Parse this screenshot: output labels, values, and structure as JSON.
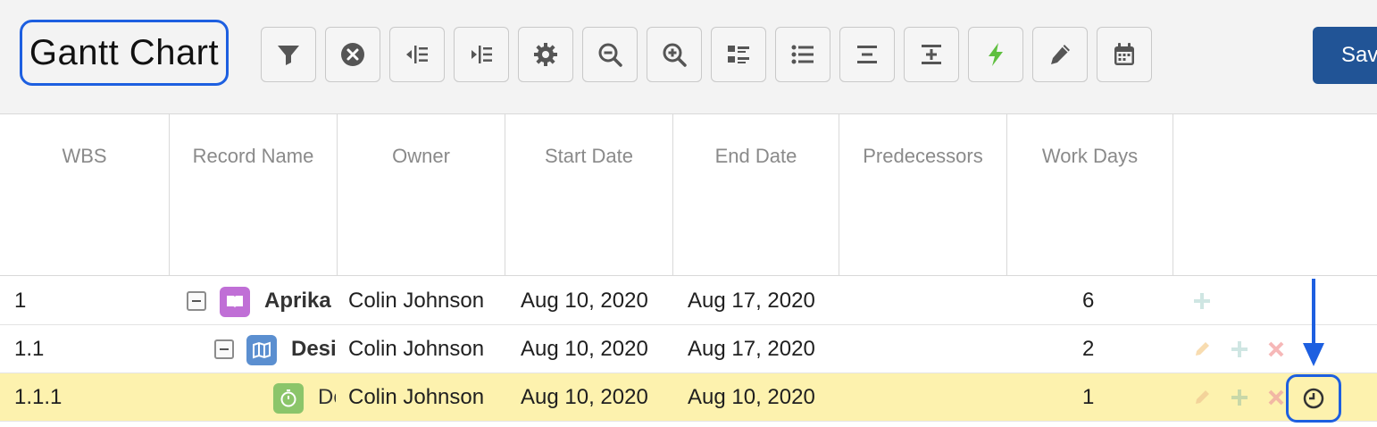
{
  "toolbar": {
    "title": "Gantt Chart",
    "save_label": "Save",
    "buttons": [
      {
        "icon": "filter-icon"
      },
      {
        "icon": "clear-filter-icon"
      },
      {
        "icon": "collapse-all-icon"
      },
      {
        "icon": "expand-all-icon"
      },
      {
        "icon": "settings-gear-icon"
      },
      {
        "icon": "zoom-out-icon"
      },
      {
        "icon": "zoom-in-icon"
      },
      {
        "icon": "outline-list-icon"
      },
      {
        "icon": "bulleted-list-icon"
      },
      {
        "icon": "align-center-icon"
      },
      {
        "icon": "insert-row-icon"
      },
      {
        "icon": "lightning-bolt-icon"
      },
      {
        "icon": "pencil-icon"
      },
      {
        "icon": "calendar-icon"
      }
    ]
  },
  "grid": {
    "columns": [
      "WBS",
      "Record Name",
      "Owner",
      "Start Date",
      "End Date",
      "Predecessors",
      "Work Days",
      ""
    ],
    "rows": [
      {
        "wbs": "1",
        "name": "Aprika",
        "owner": "Colin Johnson",
        "start": "Aug 10, 2020",
        "end": "Aug 17, 2020",
        "predecessors": "",
        "work_days": "6",
        "icon": "project-book-icon",
        "icon_color": "#c06fd6"
      },
      {
        "wbs": "1.1",
        "name": "Desi",
        "owner": "Colin Johnson",
        "start": "Aug 10, 2020",
        "end": "Aug 17, 2020",
        "predecessors": "",
        "work_days": "2",
        "icon": "phase-map-icon",
        "icon_color": "#5b8fd0"
      },
      {
        "wbs": "1.1.1",
        "name": "De",
        "owner": "Colin Johnson",
        "start": "Aug 10, 2020",
        "end": "Aug 10, 2020",
        "predecessors": "",
        "work_days": "1",
        "icon": "task-stopwatch-icon",
        "icon_color": "#8bc56a"
      }
    ]
  },
  "colors": {
    "accent_blue": "#1d5fe0",
    "save_button": "#215496",
    "selected_row": "#fdf2ae"
  }
}
